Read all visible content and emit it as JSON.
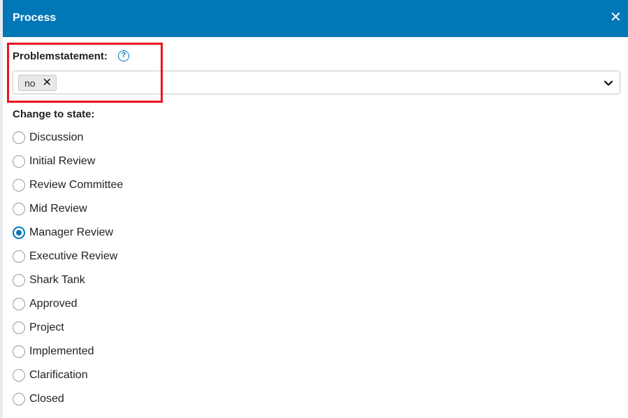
{
  "dialog": {
    "title": "Process",
    "close_icon": "close-icon"
  },
  "problemstatement": {
    "label": "Problemstatement:",
    "help_icon": "question-circle-icon",
    "selected_tags": [
      {
        "label": "no",
        "remove_icon": "times-icon"
      }
    ],
    "dropdown_icon": "chevron-down-icon"
  },
  "state": {
    "label": "Change to state:",
    "options": [
      {
        "label": "Discussion",
        "checked": false
      },
      {
        "label": "Initial Review",
        "checked": false
      },
      {
        "label": "Review Committee",
        "checked": false
      },
      {
        "label": "Mid Review",
        "checked": false
      },
      {
        "label": "Manager Review",
        "checked": true
      },
      {
        "label": "Executive Review",
        "checked": false
      },
      {
        "label": "Shark Tank",
        "checked": false
      },
      {
        "label": "Approved",
        "checked": false
      },
      {
        "label": "Project",
        "checked": false
      },
      {
        "label": "Implemented",
        "checked": false
      },
      {
        "label": "Clarification",
        "checked": false
      },
      {
        "label": "Closed",
        "checked": false
      }
    ]
  },
  "colors": {
    "header": "#0277b8",
    "radio_selected": "#0277b8",
    "highlight_box": "#e8141c"
  }
}
